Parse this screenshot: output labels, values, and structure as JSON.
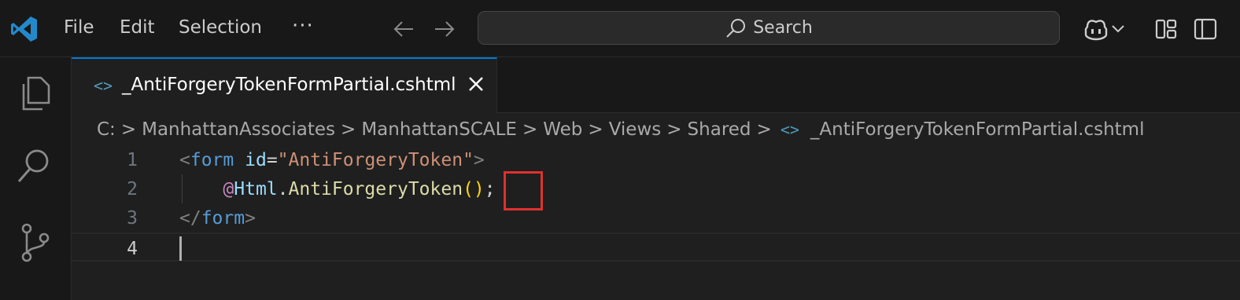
{
  "menu": {
    "file": "File",
    "edit": "Edit",
    "selection": "Selection",
    "more": "···"
  },
  "search": {
    "label": "Search"
  },
  "tab": {
    "icon": "<>",
    "label": "_AntiForgeryTokenFormPartial.cshtml"
  },
  "breadcrumb": {
    "drive": "C:",
    "segments": [
      "ManhattanAssociates",
      "ManhattanSCALE",
      "Web",
      "Views",
      "Shared"
    ],
    "file": "_AntiForgeryTokenFormPartial.cshtml"
  },
  "code": {
    "line_numbers": [
      "1",
      "2",
      "3",
      "4"
    ],
    "line1": {
      "open": "<",
      "tag": "form",
      "sp": " ",
      "attr": "id",
      "eq": "=",
      "value": "\"AntiForgeryToken\"",
      "close": ">"
    },
    "line2": {
      "indent": "    ",
      "at": "@",
      "obj": "Html",
      "dot": ".",
      "fn": "AntiForgeryToken",
      "lparen": "(",
      "rparen": ")",
      "semi": ";"
    },
    "line3": {
      "open": "</",
      "tag": "form",
      "close": ">"
    }
  },
  "colors": {
    "accent": "#0078d4",
    "highlight": "#e03030"
  },
  "icons": [
    "vscode-logo",
    "arrow-left-icon",
    "arrow-right-icon",
    "search-icon",
    "copilot-icon",
    "chevron-down-icon",
    "layout-icon",
    "split-panel-icon",
    "explorer-icon",
    "search-view-icon",
    "source-control-icon",
    "close-icon"
  ]
}
